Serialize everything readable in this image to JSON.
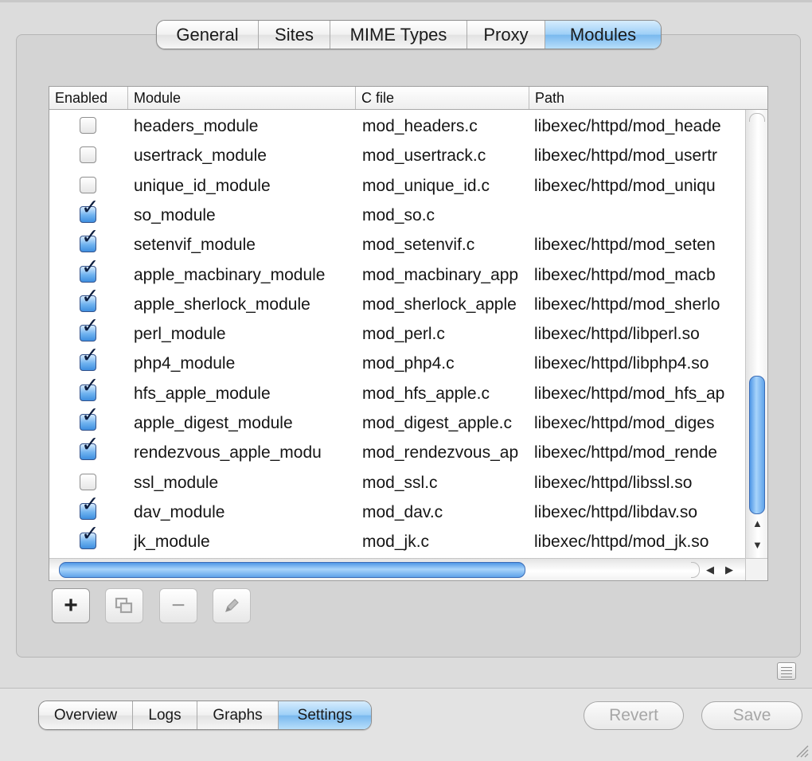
{
  "top_tabs": [
    {
      "label": "General",
      "selected": false
    },
    {
      "label": "Sites",
      "selected": false
    },
    {
      "label": "MIME Types",
      "selected": false
    },
    {
      "label": "Proxy",
      "selected": false
    },
    {
      "label": "Modules",
      "selected": true
    }
  ],
  "table": {
    "columns": [
      "Enabled",
      "Module",
      "C file",
      "Path"
    ],
    "rows": [
      {
        "enabled": false,
        "module": "headers_module",
        "cfile": "mod_headers.c",
        "path": "libexec/httpd/mod_heade"
      },
      {
        "enabled": false,
        "module": "usertrack_module",
        "cfile": "mod_usertrack.c",
        "path": "libexec/httpd/mod_usertr"
      },
      {
        "enabled": false,
        "module": "unique_id_module",
        "cfile": "mod_unique_id.c",
        "path": "libexec/httpd/mod_uniqu"
      },
      {
        "enabled": true,
        "module": "so_module",
        "cfile": "mod_so.c",
        "path": ""
      },
      {
        "enabled": true,
        "module": "setenvif_module",
        "cfile": "mod_setenvif.c",
        "path": "libexec/httpd/mod_seten"
      },
      {
        "enabled": true,
        "module": "apple_macbinary_module",
        "cfile": "mod_macbinary_app",
        "path": "libexec/httpd/mod_macb"
      },
      {
        "enabled": true,
        "module": "apple_sherlock_module",
        "cfile": "mod_sherlock_apple",
        "path": "libexec/httpd/mod_sherlo"
      },
      {
        "enabled": true,
        "module": "perl_module",
        "cfile": "mod_perl.c",
        "path": "libexec/httpd/libperl.so"
      },
      {
        "enabled": true,
        "module": "php4_module",
        "cfile": "mod_php4.c",
        "path": "libexec/httpd/libphp4.so"
      },
      {
        "enabled": true,
        "module": "hfs_apple_module",
        "cfile": "mod_hfs_apple.c",
        "path": "libexec/httpd/mod_hfs_ap"
      },
      {
        "enabled": true,
        "module": "apple_digest_module",
        "cfile": "mod_digest_apple.c",
        "path": "libexec/httpd/mod_diges"
      },
      {
        "enabled": true,
        "module": "rendezvous_apple_modu",
        "cfile": "mod_rendezvous_ap",
        "path": "libexec/httpd/mod_rende"
      },
      {
        "enabled": false,
        "module": "ssl_module",
        "cfile": "mod_ssl.c",
        "path": "libexec/httpd/libssl.so"
      },
      {
        "enabled": true,
        "module": "dav_module",
        "cfile": "mod_dav.c",
        "path": "libexec/httpd/libdav.so"
      },
      {
        "enabled": true,
        "module": "jk_module",
        "cfile": "mod_jk.c",
        "path": "libexec/httpd/mod_jk.so"
      }
    ]
  },
  "toolbar": {
    "add_label": "+",
    "duplicate_icon": "duplicate-icon",
    "remove_label": "−",
    "edit_icon": "pencil-icon"
  },
  "bottom_tabs": [
    {
      "label": "Overview",
      "selected": false
    },
    {
      "label": "Logs",
      "selected": false
    },
    {
      "label": "Graphs",
      "selected": false
    },
    {
      "label": "Settings",
      "selected": true
    }
  ],
  "buttons": {
    "revert_label": "Revert",
    "save_label": "Save"
  },
  "colors": {
    "selected_tab": "#8ec6f4",
    "checkbox_checked": "#4a97e2",
    "scroll_thumb": "#5fa3ea"
  }
}
